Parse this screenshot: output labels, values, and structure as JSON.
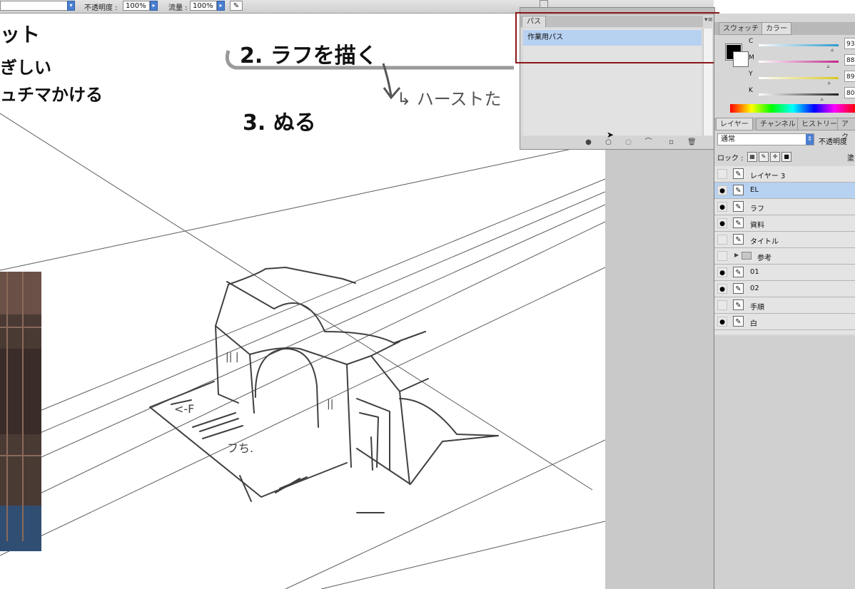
{
  "options_bar": {
    "opacity_label": "不透明度 :",
    "opacity_value": "100%",
    "flow_label": "流量 :",
    "flow_value": "100%"
  },
  "canvas_notes": {
    "note_top_left_1": "ット",
    "note_top_left_2": "ぎしい",
    "note_top_left_3": "ュチマかける",
    "step2": "2. ラフを描く",
    "step3": "3. ぬる",
    "arrow_note": "↳ ハーストた",
    "floor_label": "フち."
  },
  "paths_panel": {
    "tab_label": "パス",
    "paths": [
      "作業用パス"
    ]
  },
  "color_panel": {
    "tabs": [
      "スウォッチ",
      "カラー"
    ],
    "sliders": [
      {
        "label": "C",
        "value": "93",
        "color": "#2a9bd0",
        "level": 0.93
      },
      {
        "label": "M",
        "value": "88",
        "color": "#c0288a",
        "level": 0.88
      },
      {
        "label": "Y",
        "value": "89",
        "color": "#d7c81d",
        "level": 0.89
      },
      {
        "label": "K",
        "value": "80",
        "color": "#222222",
        "level": 0.8
      }
    ]
  },
  "layers_panel": {
    "tabs": [
      "レイヤー",
      "チャンネル",
      "ヒストリー",
      "アク"
    ],
    "blend_mode": "通常",
    "opacity_label": "不透明度",
    "lock_label": "ロック :",
    "fill_label": "塗",
    "layers": [
      {
        "name": "レイヤー 3",
        "visible": false,
        "active": false,
        "folder": false
      },
      {
        "name": "EL",
        "visible": true,
        "active": true,
        "folder": false
      },
      {
        "name": "ラフ",
        "visible": true,
        "active": false,
        "folder": false
      },
      {
        "name": "資料",
        "visible": true,
        "active": false,
        "folder": false
      },
      {
        "name": "タイトル",
        "visible": false,
        "active": false,
        "folder": false
      },
      {
        "name": "参考",
        "visible": false,
        "active": false,
        "folder": true
      },
      {
        "name": "01",
        "visible": true,
        "active": false,
        "folder": false
      },
      {
        "name": "02",
        "visible": true,
        "active": false,
        "folder": false
      },
      {
        "name": "手順",
        "visible": false,
        "active": false,
        "folder": false
      },
      {
        "name": "白",
        "visible": true,
        "active": false,
        "folder": false
      }
    ]
  },
  "icons": {
    "eye": "eye-icon",
    "brush_thumb": "brush-icon",
    "folder": "folder-icon"
  },
  "colors": {
    "highlight_box": "#8a1717",
    "selected_row": "#b7d1f1"
  }
}
